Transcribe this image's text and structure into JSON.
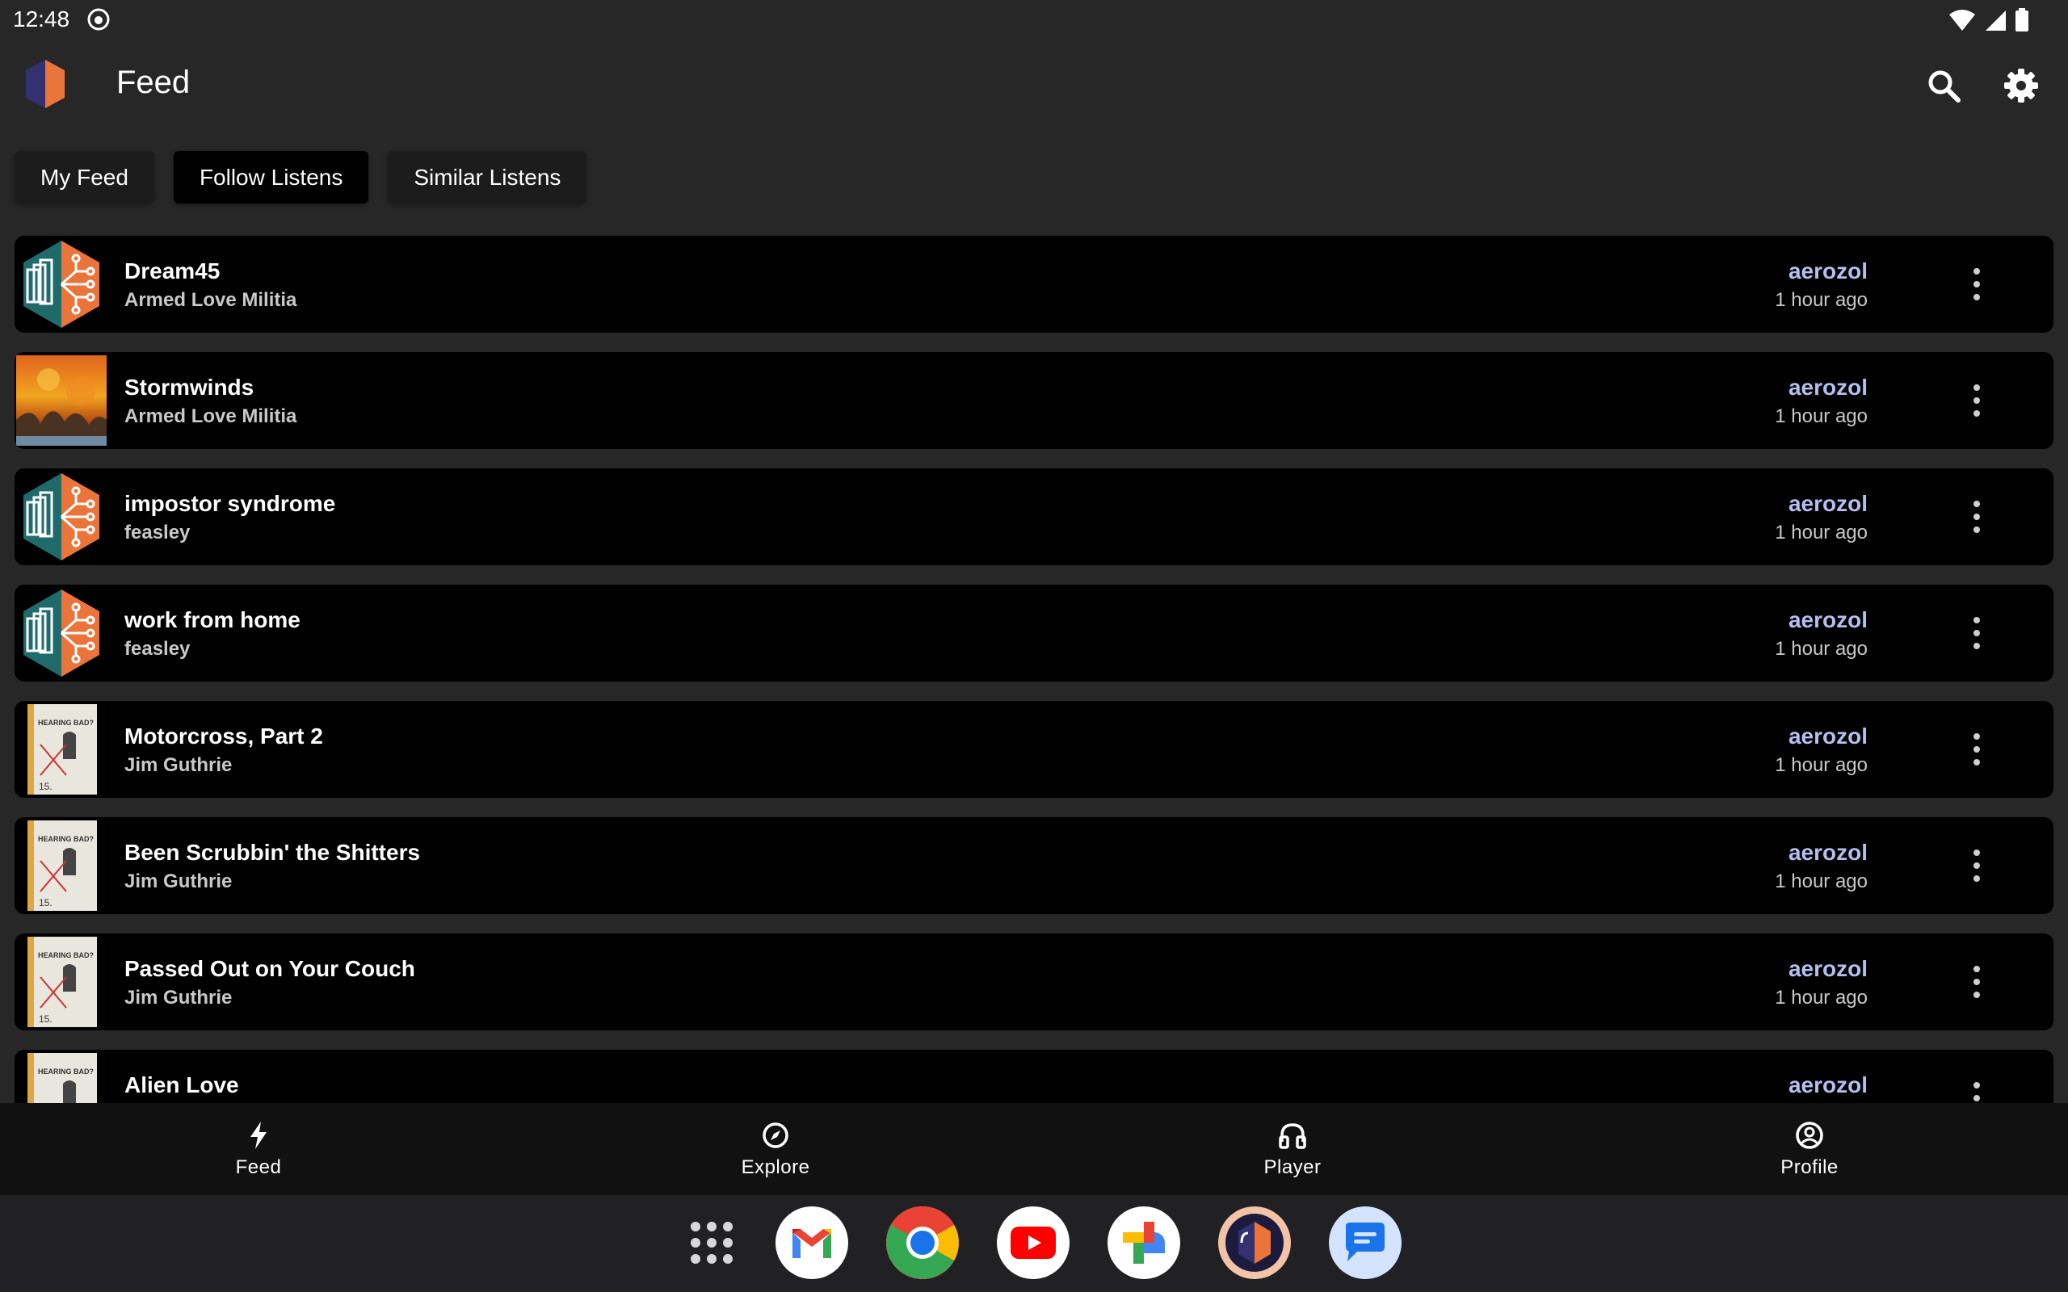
{
  "status_bar": {
    "time": "12:48"
  },
  "app_bar": {
    "title": "Feed"
  },
  "tabs": [
    {
      "label": "My Feed",
      "active": false
    },
    {
      "label": "Follow Listens",
      "active": true
    },
    {
      "label": "Similar Listens",
      "active": false
    }
  ],
  "listens": [
    {
      "title": "Dream45",
      "artist": "Armed Love Militia",
      "user": "aerozol",
      "time": "1 hour ago",
      "cover": "listenbrainz-placeholder"
    },
    {
      "title": "Stormwinds",
      "artist": "Armed Love Militia",
      "user": "aerozol",
      "time": "1 hour ago",
      "cover": "fire-artwork"
    },
    {
      "title": "impostor syndrome",
      "artist": "feasley",
      "user": "aerozol",
      "time": "1 hour ago",
      "cover": "listenbrainz-placeholder"
    },
    {
      "title": "work from home",
      "artist": "feasley",
      "user": "aerozol",
      "time": "1 hour ago",
      "cover": "listenbrainz-placeholder"
    },
    {
      "title": "Motorcross, Part 2",
      "artist": "Jim Guthrie",
      "user": "aerozol",
      "time": "1 hour ago",
      "cover": "hearing-bad-artwork"
    },
    {
      "title": "Been Scrubbin' the Shitters",
      "artist": "Jim Guthrie",
      "user": "aerozol",
      "time": "1 hour ago",
      "cover": "hearing-bad-artwork"
    },
    {
      "title": "Passed Out on Your Couch",
      "artist": "Jim Guthrie",
      "user": "aerozol",
      "time": "1 hour ago",
      "cover": "hearing-bad-artwork"
    },
    {
      "title": "Alien Love",
      "artist": "",
      "user": "aerozol",
      "time": "",
      "cover": "hearing-bad-artwork"
    }
  ],
  "cover_art_text": "HEARING BAD?",
  "bottom_nav": [
    {
      "label": "Feed",
      "icon": "bolt-icon",
      "active": true
    },
    {
      "label": "Explore",
      "icon": "compass-icon",
      "active": false
    },
    {
      "label": "Player",
      "icon": "headphones-icon",
      "active": false
    },
    {
      "label": "Profile",
      "icon": "account-circle-icon",
      "active": false
    }
  ],
  "dock": [
    {
      "name": "app-drawer",
      "icon": "app-grid-icon"
    },
    {
      "name": "gmail",
      "icon": "gmail-icon"
    },
    {
      "name": "chrome",
      "icon": "chrome-icon"
    },
    {
      "name": "youtube",
      "icon": "youtube-icon"
    },
    {
      "name": "photos",
      "icon": "photos-icon"
    },
    {
      "name": "listenbrainz",
      "icon": "listenbrainz-icon"
    },
    {
      "name": "messages",
      "icon": "messages-icon"
    }
  ],
  "colors": {
    "background": "#272727",
    "row_background": "#000000",
    "username": "#b4bff0",
    "secondary_text": "#c9c9c9",
    "brand_orange": "#eb743b",
    "brand_purple": "#353070",
    "placeholder_teal": "#1f6b6b"
  }
}
